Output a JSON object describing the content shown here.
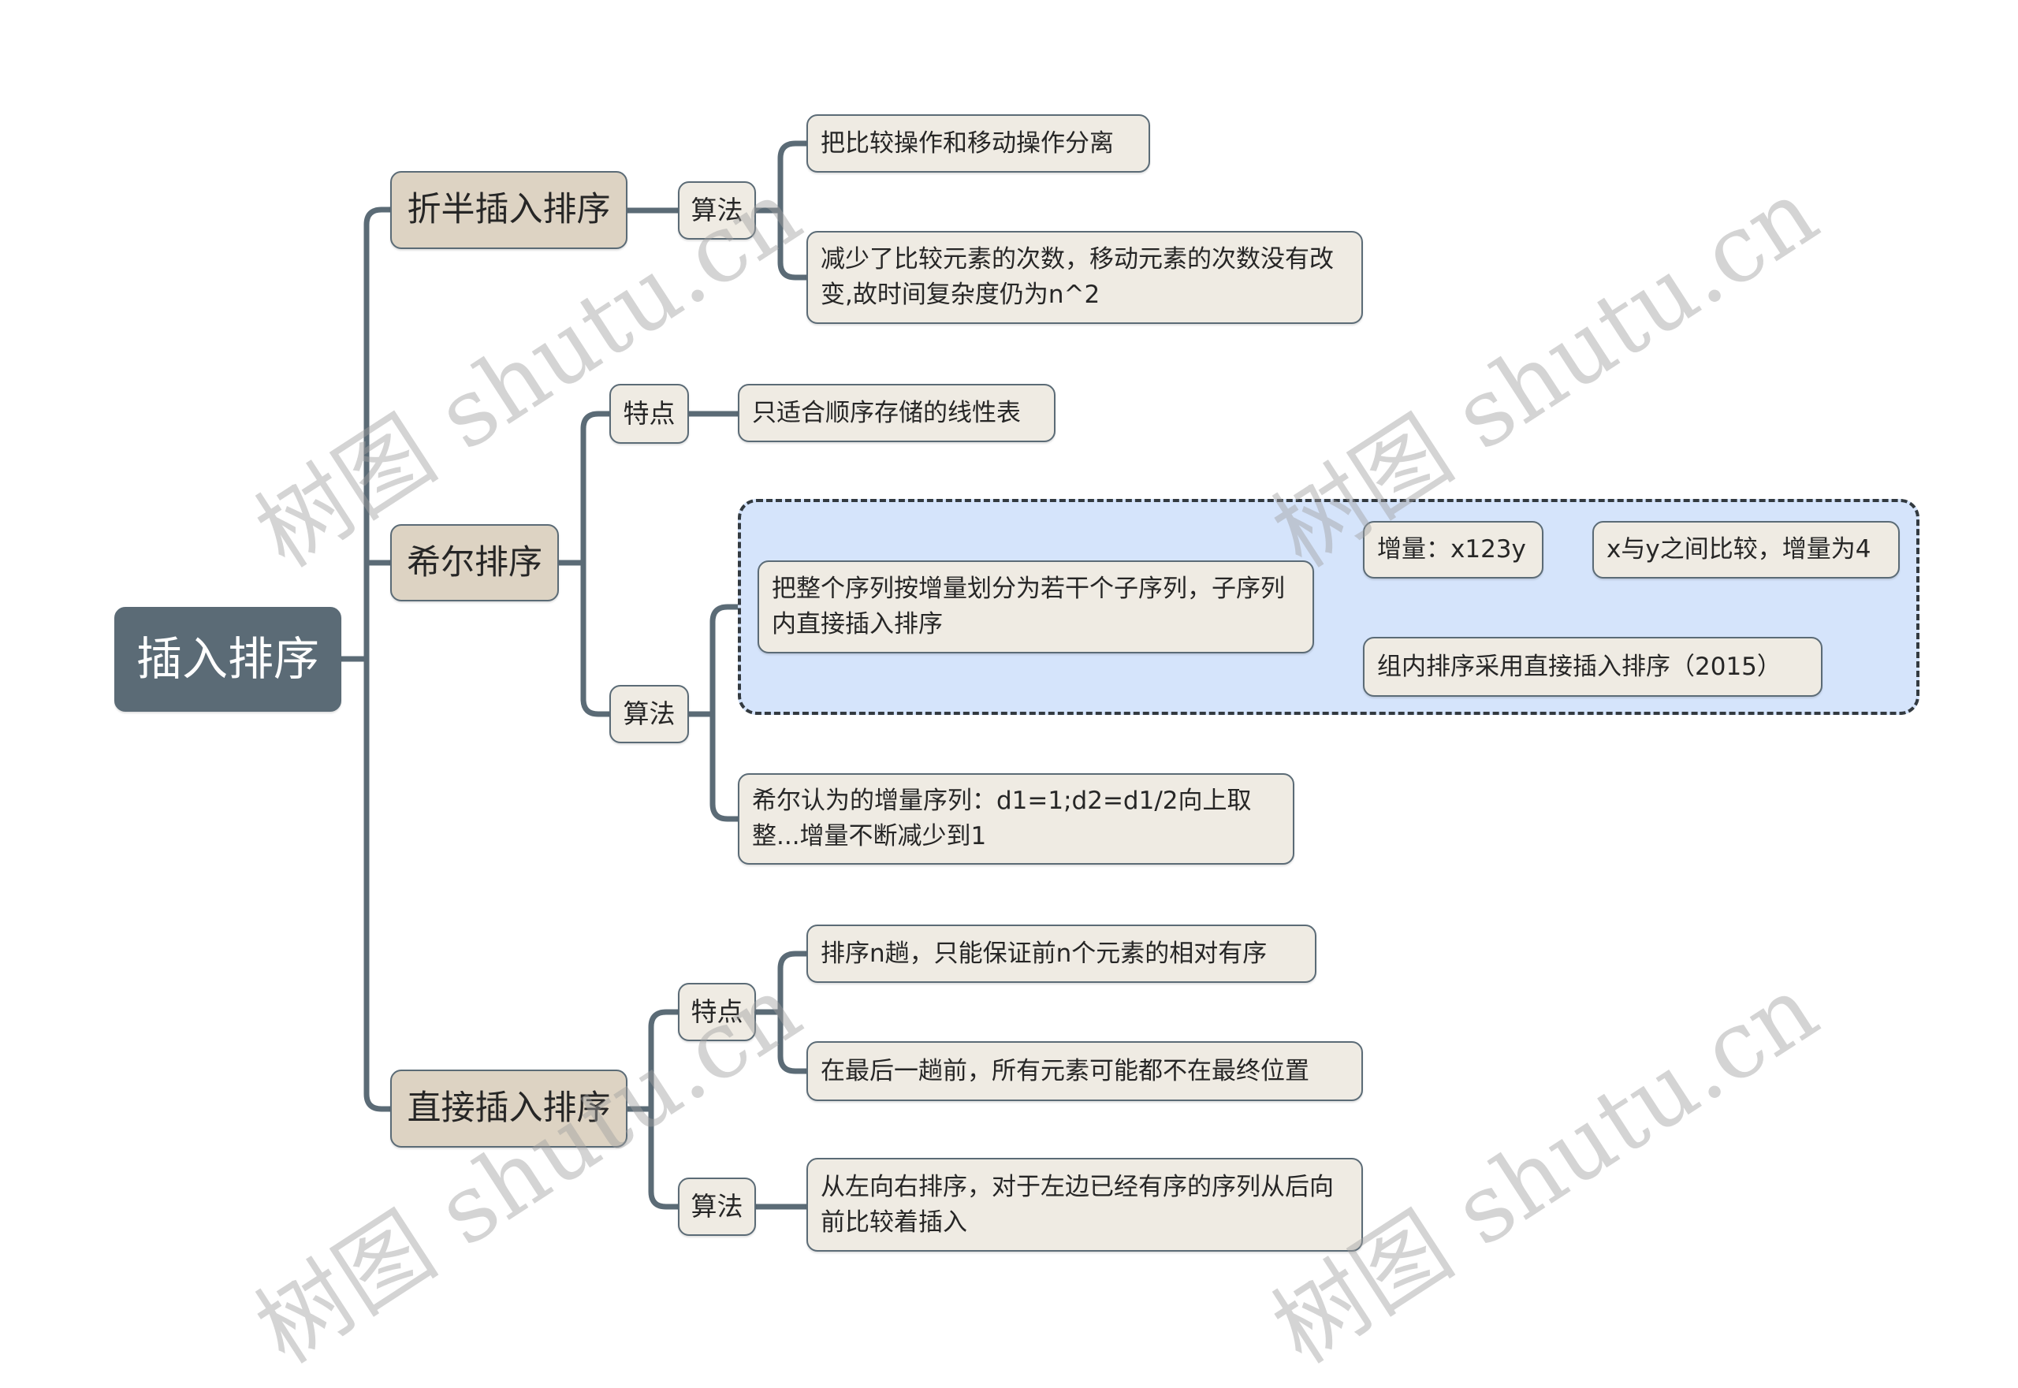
{
  "root": "插入排序",
  "watermark": "树图 shutu.cn",
  "colors": {
    "root_fill": "#5b6b76",
    "branch_fill": "#ddd3c3",
    "leaf_fill": "#efebe3",
    "line": "#5b6b76",
    "highlight_fill": "#d5e4fb"
  },
  "branches": [
    {
      "label": "折半插入排序",
      "children": [
        {
          "label": "算法",
          "children": [
            {
              "label": "把比较操作和移动操作分离"
            },
            {
              "label": "减少了比较元素的次数，移动元素的次数没有改变,故时间复杂度仍为n^2"
            }
          ]
        }
      ]
    },
    {
      "label": "希尔排序",
      "children": [
        {
          "label": "特点",
          "children": [
            {
              "label": "只适合顺序存储的线性表"
            }
          ]
        },
        {
          "label": "算法",
          "children": [
            {
              "label": "把整个序列按增量划分为若干个子序列，子序列内直接插入排序",
              "highlighted": true,
              "children": [
                {
                  "label": "增量：x123y",
                  "children": [
                    {
                      "label": "x与y之间比较，增量为4"
                    }
                  ]
                },
                {
                  "label": "组内排序采用直接插入排序（2015）"
                }
              ]
            },
            {
              "label": "希尔认为的增量序列：d1=1;d2=d1/2向上取整...增量不断减少到1"
            }
          ]
        }
      ]
    },
    {
      "label": "直接插入排序",
      "children": [
        {
          "label": "特点",
          "children": [
            {
              "label": "排序n趟，只能保证前n个元素的相对有序"
            },
            {
              "label": "在最后一趟前，所有元素可能都不在最终位置"
            }
          ]
        },
        {
          "label": "算法",
          "children": [
            {
              "label": "从左向右排序，对于左边已经有序的序列从后向前比较着插入"
            }
          ]
        }
      ]
    }
  ]
}
